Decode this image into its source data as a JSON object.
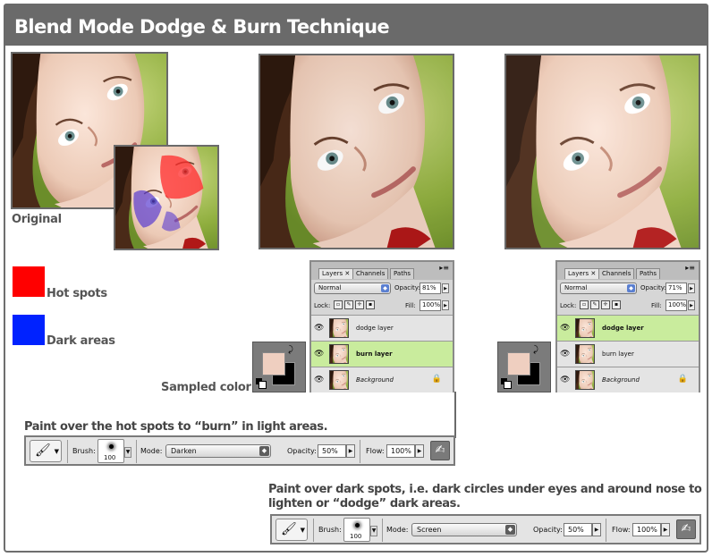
{
  "title": "Blend Mode Dodge & Burn Technique",
  "captions": {
    "original": "Original",
    "sampled_color": "Sampled color"
  },
  "legend": [
    {
      "label": "Hot spots",
      "color": "#ff0000"
    },
    {
      "label": "Dark areas",
      "color": "#0022ff"
    }
  ],
  "colors": {
    "sampled": "#efcfc0",
    "panel_bg": "#d6d6d6",
    "selected_layer": "#c9ec9d"
  },
  "layers_panels": [
    {
      "tabs": [
        "Layers",
        "Channels",
        "Paths"
      ],
      "blend_mode": "Normal",
      "opacity_label": "Opacity:",
      "opacity": "81%",
      "lock_label": "Lock:",
      "fill_label": "Fill:",
      "fill": "100%",
      "layers": [
        {
          "name": "dodge layer",
          "selected": false,
          "style": "plain"
        },
        {
          "name": "burn layer",
          "selected": true,
          "style": "bold"
        },
        {
          "name": "Background",
          "selected": false,
          "style": "italic"
        }
      ]
    },
    {
      "tabs": [
        "Layers",
        "Channels",
        "Paths"
      ],
      "blend_mode": "Normal",
      "opacity_label": "Opacity:",
      "opacity": "71%",
      "lock_label": "Lock:",
      "fill_label": "Fill:",
      "fill": "100%",
      "layers": [
        {
          "name": "dodge layer",
          "selected": true,
          "style": "bold"
        },
        {
          "name": "burn layer",
          "selected": false,
          "style": "plain"
        },
        {
          "name": "Background",
          "selected": false,
          "style": "italic"
        }
      ]
    }
  ],
  "instructions": {
    "burn": "Paint over the hot spots to “burn” in light areas.",
    "dodge_line1": "Paint over dark spots, i.e. dark circles under eyes and around nose to",
    "dodge_line2": "lighten or “dodge” dark areas."
  },
  "toolbars": [
    {
      "brush_label": "Brush:",
      "brush_size": "100",
      "mode_label": "Mode:",
      "mode": "Darken",
      "opacity_label": "Opacity:",
      "opacity": "50%",
      "flow_label": "Flow:",
      "flow": "100%"
    },
    {
      "brush_label": "Brush:",
      "brush_size": "100",
      "mode_label": "Mode:",
      "mode": "Screen",
      "opacity_label": "Opacity:",
      "opacity": "50%",
      "flow_label": "Flow:",
      "flow": "100%"
    }
  ]
}
